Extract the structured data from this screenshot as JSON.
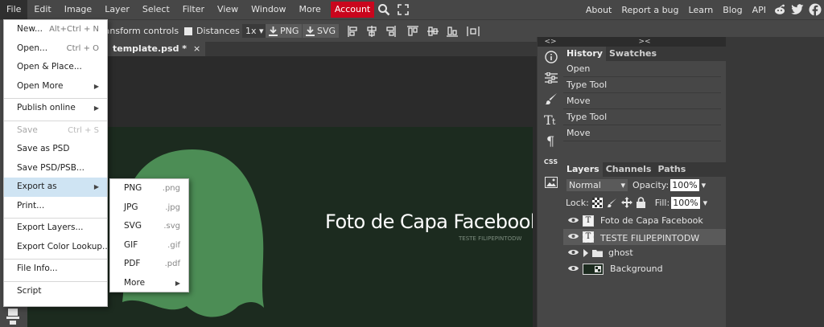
{
  "menubar": {
    "items": [
      "File",
      "Edit",
      "Image",
      "Layer",
      "Select",
      "Filter",
      "View",
      "Window",
      "More"
    ],
    "account": "Account",
    "links": [
      "About",
      "Report a bug",
      "Learn",
      "Blog",
      "API"
    ],
    "icons": [
      "search-icon",
      "fullscreen-icon",
      "reddit-icon",
      "twitter-icon",
      "facebook-icon"
    ]
  },
  "options": {
    "transform_controls": "Transform controls",
    "distances": "Distances",
    "zoom": "1x",
    "png": "PNG",
    "svg": "SVG"
  },
  "document_tab": {
    "title": "template.psd *",
    "close": "×"
  },
  "file_menu": {
    "items": [
      {
        "label": "New...",
        "shortcut": "Alt+Ctrl + N"
      },
      {
        "label": "Open...",
        "shortcut": "Ctrl + O"
      },
      {
        "label": "Open & Place..."
      },
      {
        "label": "Open More",
        "submenu": true
      },
      {
        "label": "Publish online",
        "submenu": true
      },
      {
        "label": "Save",
        "shortcut": "Ctrl + S",
        "disabled": true
      },
      {
        "label": "Save as PSD"
      },
      {
        "label": "Save PSD/PSB..."
      },
      {
        "label": "Export as",
        "submenu": true,
        "highlighted": true
      },
      {
        "label": "Print..."
      },
      {
        "label": "Export Layers..."
      },
      {
        "label": "Export Color Lookup..."
      },
      {
        "label": "File Info..."
      },
      {
        "label": "Script"
      }
    ]
  },
  "export_menu": {
    "items": [
      {
        "label": "PNG",
        "ext": ".png"
      },
      {
        "label": "JPG",
        "ext": ".jpg"
      },
      {
        "label": "SVG",
        "ext": ".svg"
      },
      {
        "label": "GIF",
        "ext": ".gif"
      },
      {
        "label": "PDF",
        "ext": ".pdf"
      },
      {
        "label": "More",
        "submenu": true
      }
    ]
  },
  "canvas": {
    "title": "Foto de Capa Facebook",
    "subtitle": "TESTE FILIPEPINTODW",
    "background": "#1c2b1f",
    "ghost_color": "#4c8d55"
  },
  "history_panel": {
    "tabs": [
      "History",
      "Swatches"
    ],
    "items": [
      "Open",
      "Type Tool",
      "Move",
      "Type Tool",
      "Move"
    ]
  },
  "layers_panel": {
    "tabs": [
      "Layers",
      "Channels",
      "Paths"
    ],
    "blend_mode": "Normal",
    "opacity_label": "Opacity:",
    "opacity": "100%",
    "lock_label": "Lock:",
    "fill_label": "Fill:",
    "fill": "100%",
    "layers": [
      {
        "name": "Foto de Capa Facebook",
        "type": "text"
      },
      {
        "name": "TESTE FILIPEPINTODW",
        "type": "text",
        "selected": true
      },
      {
        "name": "ghost",
        "type": "folder"
      },
      {
        "name": "Background",
        "type": "image"
      }
    ]
  },
  "narrow_panel": {
    "css_label": "CSS",
    "icons": [
      "info-icon",
      "adjustments-icon",
      "brush-icon",
      "character-icon",
      "paragraph-icon",
      "css-icon",
      "image-icon"
    ]
  },
  "colors": {
    "account": "#c9061d",
    "menu_highlight": "#cfe4f3"
  }
}
